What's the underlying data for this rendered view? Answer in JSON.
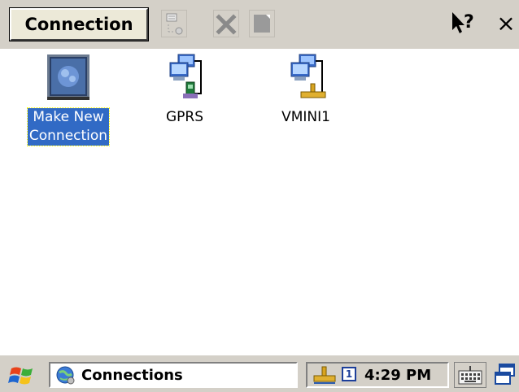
{
  "command_bar": {
    "menu_label": "Connection",
    "toolbar_icons": [
      "properties-icon",
      "delete-icon",
      "rename-icon"
    ],
    "help_icon": "help-cursor-icon",
    "close_label": "×"
  },
  "items": [
    {
      "label_line1": "Make New",
      "label_line2": "Connection",
      "icon": "make-new-connection-icon",
      "selected": true
    },
    {
      "label": "GPRS",
      "icon": "gprs-connection-icon"
    },
    {
      "label": "VMINI1",
      "icon": "network-connection-icon"
    }
  ],
  "taskbar": {
    "task_label": "Connections",
    "tray_badge": "1",
    "clock": "4:29 PM"
  },
  "colors": {
    "selection": "#316ac5",
    "bar": "#d4d0c8"
  }
}
